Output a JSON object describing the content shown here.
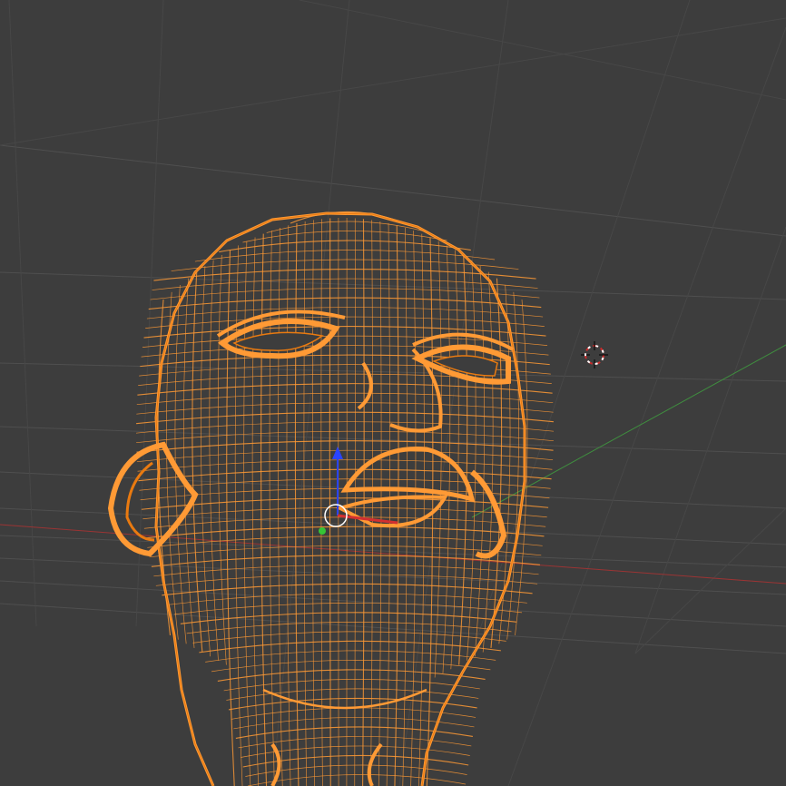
{
  "app": "3D viewport",
  "viewport": {
    "view_mode": "wireframe",
    "background_color": "#3d3d3d",
    "grid_color": "#4f4f4f",
    "grid_minor_color": "#474747",
    "x_axis_color": "#9b3434",
    "y_axis_color": "#3f8f3f",
    "selection_color": "#ff9a35",
    "selection_dark_color": "#e97a10"
  },
  "scene": {
    "object": {
      "type": "mesh",
      "shape": "human head",
      "selected": true,
      "display": "wireframe"
    },
    "cursor": {
      "icon": "3d-cursor-icon",
      "color_outer": "#cc2a2a",
      "color_inner": "#ffffff"
    },
    "gizmo": {
      "icon": "transform-gizmo-icon",
      "z_color": "#2a44ff",
      "y_color": "#35c535",
      "x_color": "#d23030",
      "origin_color": "#ffffff"
    }
  }
}
